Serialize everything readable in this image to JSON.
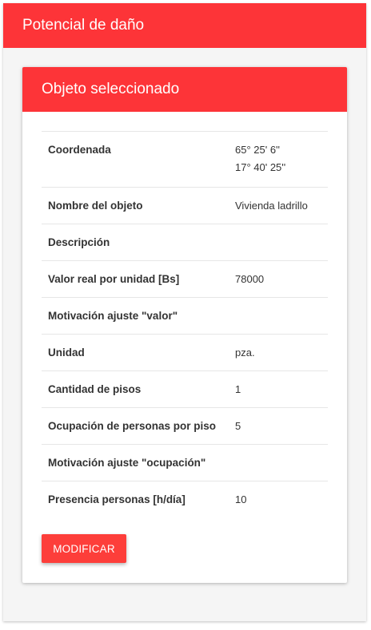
{
  "outer": {
    "title": "Potencial de daño"
  },
  "card": {
    "title": "Objeto seleccionado",
    "rows": [
      {
        "label": "Coordenada",
        "values": [
          "65° 25' 6''",
          "17° 40' 25''"
        ]
      },
      {
        "label": "Nombre del objeto",
        "values": [
          "Vivienda ladrillo"
        ]
      },
      {
        "label": "Descripción",
        "values": [
          ""
        ]
      },
      {
        "label": "Valor real por unidad [Bs]",
        "values": [
          "78000"
        ]
      },
      {
        "label": "Motivación ajuste \"valor\"",
        "values": [
          ""
        ]
      },
      {
        "label": "Unidad",
        "values": [
          "pza."
        ]
      },
      {
        "label": "Cantidad de pisos",
        "values": [
          "1"
        ]
      },
      {
        "label": "Ocupación de personas por piso",
        "values": [
          "5"
        ]
      },
      {
        "label": "Motivación ajuste \"ocupación\"",
        "values": [
          ""
        ]
      },
      {
        "label": "Presencia personas [h/día]",
        "values": [
          "10"
        ]
      }
    ],
    "button_label": "MODIFICAR"
  },
  "colors": {
    "accent": "#fd3438",
    "button": "#fd3e3a"
  }
}
